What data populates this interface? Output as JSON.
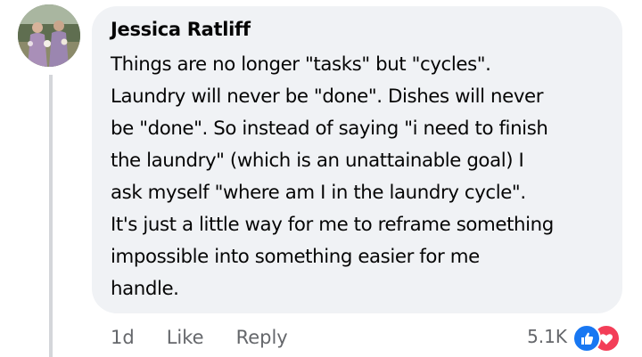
{
  "comment": {
    "author": "Jessica Ratliff",
    "lines": [
      "Things are no longer \"tasks\" but \"cycles\".",
      "Laundry will never be \"done\". Dishes will never",
      "be \"done\". So instead of saying \"i need to finish",
      "the laundry\" (which is an unattainable goal) I",
      "ask myself \"where am I in the laundry cycle\".",
      "It's just a little way for me to reframe something",
      "impossible into something easier for me",
      "handle."
    ]
  },
  "actions": {
    "time": "1d",
    "like": "Like",
    "reply": "Reply"
  },
  "reactions": {
    "count": "5.1K",
    "icons": [
      "like-reaction-icon",
      "love-reaction-icon"
    ],
    "colors": {
      "like": "#1877f2",
      "love": "#f33e58"
    }
  },
  "colors": {
    "bubble_bg": "#f0f2f5",
    "meta_text": "#65676b",
    "thread_line": "#d4d6da"
  }
}
